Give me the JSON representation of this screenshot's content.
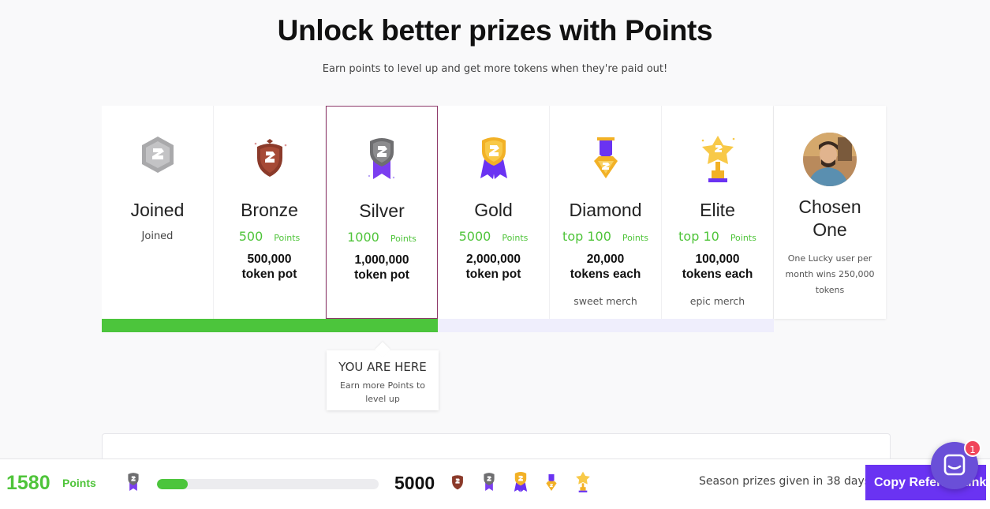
{
  "header": {
    "title": "Unlock better prizes with Points",
    "subtitle": "Earn points to level up and get more tokens when they're paid out!"
  },
  "tiers": [
    {
      "name": "Joined",
      "plain": "Joined",
      "badge_icon": "joined-badge-icon"
    },
    {
      "name": "Bronze",
      "points": "500",
      "points_label": "Points",
      "reward": "500,000\ntoken pot",
      "badge_icon": "bronze-shield-icon"
    },
    {
      "name": "Silver",
      "points": "1000",
      "points_label": "Points",
      "reward": "1,000,000\ntoken pot",
      "badge_icon": "silver-ribbon-icon",
      "current": true
    },
    {
      "name": "Gold",
      "points": "5000",
      "points_label": "Points",
      "reward": "2,000,000\ntoken pot",
      "badge_icon": "gold-medal-icon"
    },
    {
      "name": "Diamond",
      "points": "top 100",
      "points_label": "Points",
      "reward": "20,000\ntokens each",
      "extra": "sweet merch",
      "badge_icon": "diamond-medal-icon"
    },
    {
      "name": "Elite",
      "points": "top 10",
      "points_label": "Points",
      "reward": "100,000\ntokens each",
      "extra": "epic merch",
      "badge_icon": "elite-trophy-icon"
    },
    {
      "name": "Chosen\nOne",
      "description": "One Lucky user per month wins 250,000 tokens",
      "badge_icon": "chosen-one-avatar"
    }
  ],
  "progress": {
    "fraction": 0.5
  },
  "you_are_here": {
    "title": "YOU ARE HERE",
    "subtitle": "Earn more Points to level up"
  },
  "bottom_bar": {
    "points": "1580",
    "points_label": "Points",
    "progress_fraction": 0.14,
    "target": "5000",
    "season_text": "Season prizes given in 38 days",
    "copy_button_label": "Copy Referral Link"
  },
  "chat": {
    "unread": "1"
  },
  "colors": {
    "accent": "#6a33f2",
    "green": "#4cc53c",
    "current_border": "#8e3a6a"
  }
}
